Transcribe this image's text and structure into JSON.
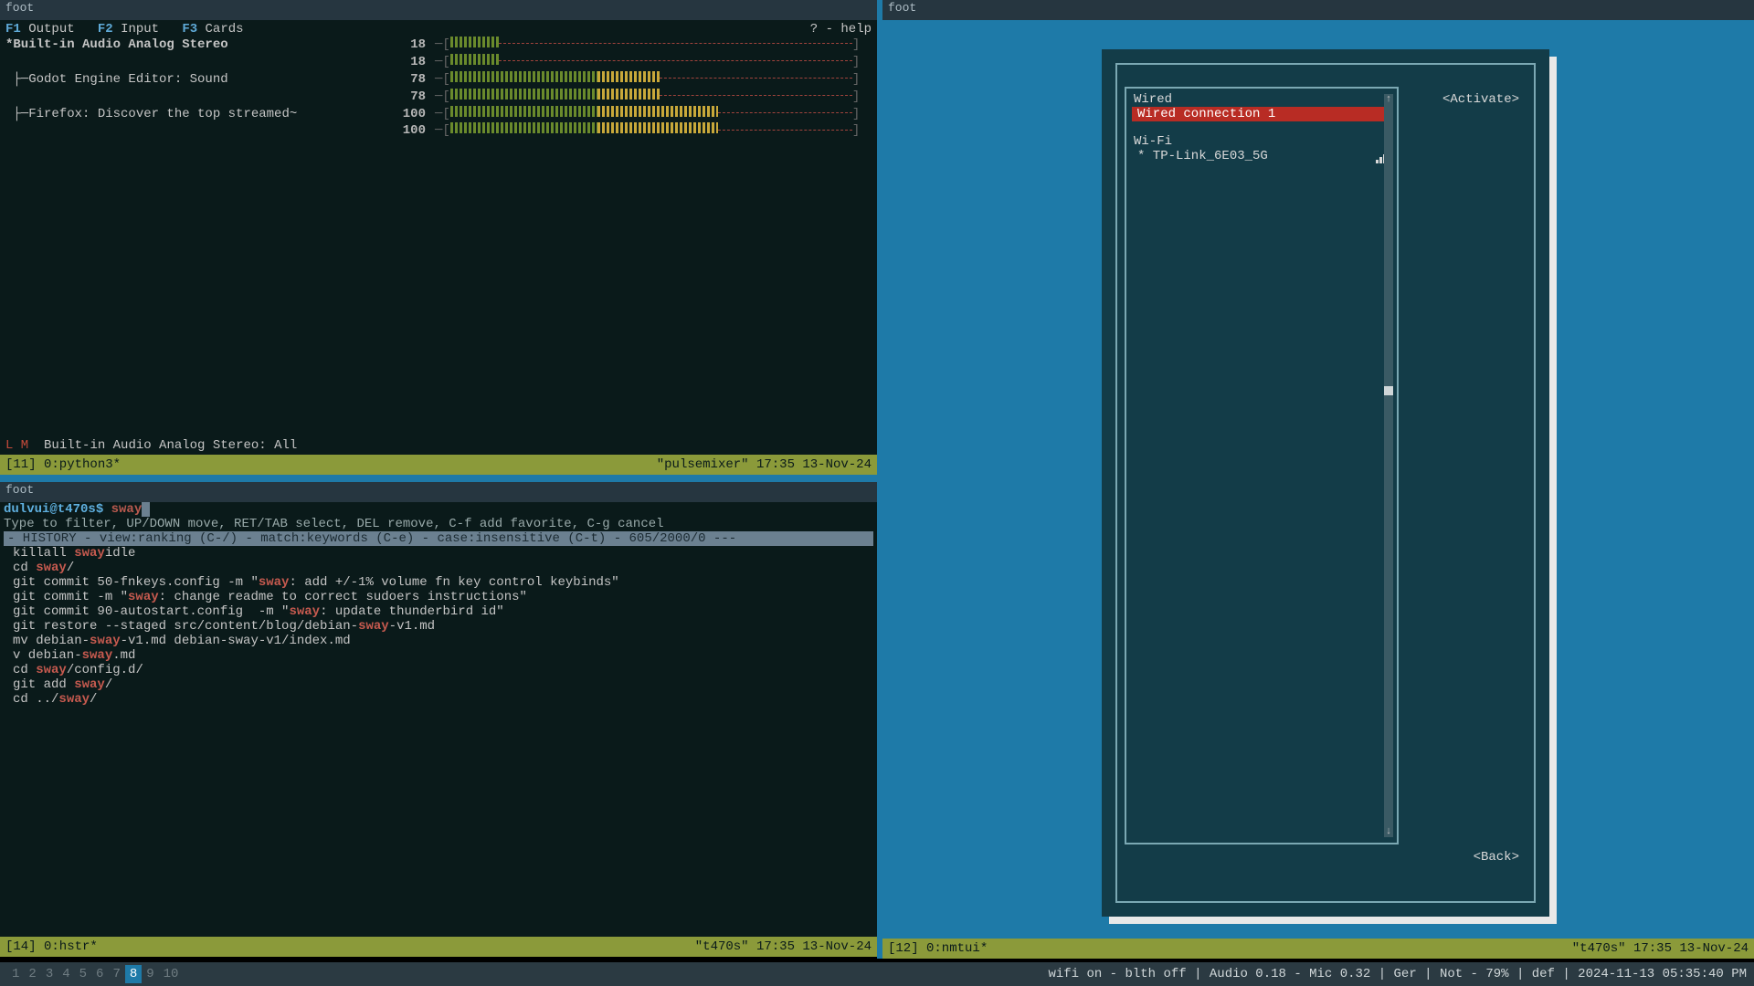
{
  "terminal_title": "foot",
  "pulsemixer": {
    "keys": {
      "f1": "F1",
      "f1l": "Output",
      "f2": "F2",
      "f2l": "Input",
      "f3": "F3",
      "f3l": "Cards"
    },
    "help": "? - help",
    "streams": [
      {
        "label": "*Built-in Audio Analog Stereo",
        "bold": true,
        "vals": [
          18,
          18
        ]
      },
      {
        "label": " Godot Engine Editor: Sound",
        "bold": false,
        "vals": [
          78,
          78
        ]
      },
      {
        "label": " Firefox: Discover the top streamed~",
        "bold": false,
        "vals": [
          100,
          100
        ]
      }
    ],
    "footer_lm": "L M",
    "footer_text": "Built-in Audio Analog Stereo: All",
    "tmux_left": "[11] 0:python3*",
    "tmux_right": "\"pulsemixer\" 17:35 13-Nov-24"
  },
  "hstr": {
    "prompt_user": "dulvui@t470s$",
    "prompt_cmd": "sway",
    "hint": "Type to filter, UP/DOWN move, RET/TAB select, DEL remove, C-f add favorite, C-g cancel",
    "banner": "- HISTORY - view:ranking (C-/) - match:keywords (C-e) - case:insensitive (C-t) - 605/2000/0 ---",
    "lines": [
      {
        "pre": "killall ",
        "m": "sway",
        "post": "idle"
      },
      {
        "pre": "cd ",
        "m": "sway",
        "post": "/"
      },
      {
        "pre": "git commit 50-fnkeys.config -m \"",
        "m": "sway",
        "post": ": add +/-1% volume fn key control keybinds\""
      },
      {
        "pre": "git commit -m \"",
        "m": "sway",
        "post": ": change readme to correct sudoers instructions\""
      },
      {
        "pre": "git commit 90-autostart.config  -m \"",
        "m": "sway",
        "post": ": update thunderbird id\""
      },
      {
        "pre": "git restore --staged src/content/blog/debian-",
        "m": "sway",
        "post": "-v1.md"
      },
      {
        "pre": "mv debian-",
        "m": "sway",
        "post": "-v1.md debian-sway-v1/index.md"
      },
      {
        "pre": "v debian-",
        "m": "sway",
        "post": ".md"
      },
      {
        "pre": "cd ",
        "m": "sway",
        "post": "/config.d/"
      },
      {
        "pre": "git add ",
        "m": "sway",
        "post": "/"
      },
      {
        "pre": "cd ../",
        "m": "sway",
        "post": "/"
      }
    ],
    "tmux_left": "[14] 0:hstr*",
    "tmux_right": "\"t470s\" 17:35 13-Nov-24"
  },
  "nmtui": {
    "wired_hdr": "Wired",
    "wired_sel": "Wired connection 1",
    "wifi_hdr": "Wi-Fi",
    "wifi_item": "* TP-Link_6E03_5G",
    "activate": "<Activate>",
    "back": "<Back>",
    "tmux_left": "[12] 0:nmtui*",
    "tmux_right": "\"t470s\" 17:35 13-Nov-24"
  },
  "swaybar": {
    "workspaces": [
      "1",
      "2",
      "3",
      "4",
      "5",
      "6",
      "7",
      "8",
      "9",
      "10"
    ],
    "active_ws": "8",
    "status": "wifi on - blth off | Audio 0.18 - Mic 0.32 | Ger | Not - 79% | def | 2024-11-13 05:35:40 PM"
  }
}
